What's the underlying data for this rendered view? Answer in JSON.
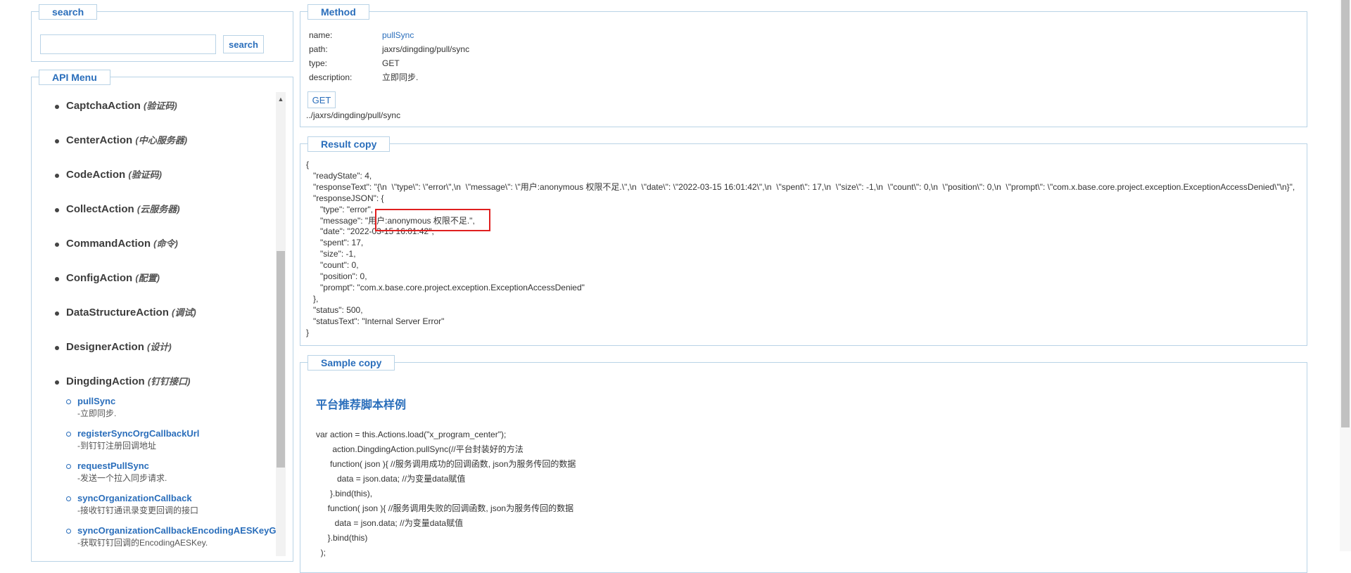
{
  "search": {
    "legend": "search",
    "input_value": "",
    "button_label": "search"
  },
  "menu": {
    "legend": "API Menu",
    "items": [
      {
        "name": "CaptchaAction",
        "desc": "(验证码)"
      },
      {
        "name": "CenterAction",
        "desc": "(中心服务器)"
      },
      {
        "name": "CodeAction",
        "desc": "(验证码)"
      },
      {
        "name": "CollectAction",
        "desc": "(云服务器)"
      },
      {
        "name": "CommandAction",
        "desc": "(命令)"
      },
      {
        "name": "ConfigAction",
        "desc": "(配置)"
      },
      {
        "name": "DataStructureAction",
        "desc": "(调试)"
      },
      {
        "name": "DesignerAction",
        "desc": "(设计)"
      },
      {
        "name": "DingdingAction",
        "desc": "(钉钉接口)"
      }
    ],
    "sub_items": [
      {
        "name": "pullSync",
        "desc": "-立即同步."
      },
      {
        "name": "registerSyncOrgCallbackUrl",
        "desc": "-到钉钉注册回调地址"
      },
      {
        "name": "requestPullSync",
        "desc": "-发送一个拉入同步请求."
      },
      {
        "name": "syncOrganizationCallback",
        "desc": "-接收钉钉通讯录变更回调的接口"
      },
      {
        "name": "syncOrganizationCallbackEncodingAESKeyGet",
        "desc": "-获取钉钉回调的EncodingAESKey."
      }
    ]
  },
  "method": {
    "legend": "Method",
    "name_key": "name:",
    "name_value": "pullSync",
    "path_key": "path:",
    "path_value": "jaxrs/dingding/pull/sync",
    "type_key": "type:",
    "type_value": "GET",
    "desc_key": "description:",
    "desc_value": "立即同步.",
    "button_label": "GET",
    "url": "../jaxrs/dingding/pull/sync"
  },
  "result": {
    "legend": "Result copy",
    "text": "{\n   \"readyState\": 4,\n   \"responseText\": \"{\\n  \\\"type\\\": \\\"error\\\",\\n  \\\"message\\\": \\\"用户:anonymous 权限不足.\\\",\\n  \\\"date\\\": \\\"2022-03-15 16:01:42\\\",\\n  \\\"spent\\\": 17,\\n  \\\"size\\\": -1,\\n  \\\"count\\\": 0,\\n  \\\"position\\\": 0,\\n  \\\"prompt\\\": \\\"com.x.base.core.project.exception.ExceptionAccessDenied\\\"\\n}\",\n   \"responseJSON\": {\n      \"type\": \"error\",\n      \"message\": \"用户:anonymous 权限不足.\",\n      \"date\": \"2022-03-15 16:01:42\",\n      \"spent\": 17,\n      \"size\": -1,\n      \"count\": 0,\n      \"position\": 0,\n      \"prompt\": \"com.x.base.core.project.exception.ExceptionAccessDenied\"\n   },\n   \"status\": 500,\n   \"statusText\": \"Internal Server Error\"\n}"
  },
  "sample": {
    "legend": "Sample copy",
    "title": "平台推荐脚本样例",
    "code": "var action = this.Actions.load(\"x_program_center\");\n       action.DingdingAction.pullSync(//平台封装好的方法\n      function( json ){ //服务调用成功的回调函数, json为服务传回的数据\n         data = json.data; //为变量data赋值\n      }.bind(this),\n     function( json ){ //服务调用失败的回调函数, json为服务传回的数据\n        data = json.data; //为变量data赋值\n     }.bind(this)\n  );"
  },
  "colors": {
    "accent": "#2a6ebb",
    "border": "#b9d3e6",
    "highlight": "#e02020"
  }
}
